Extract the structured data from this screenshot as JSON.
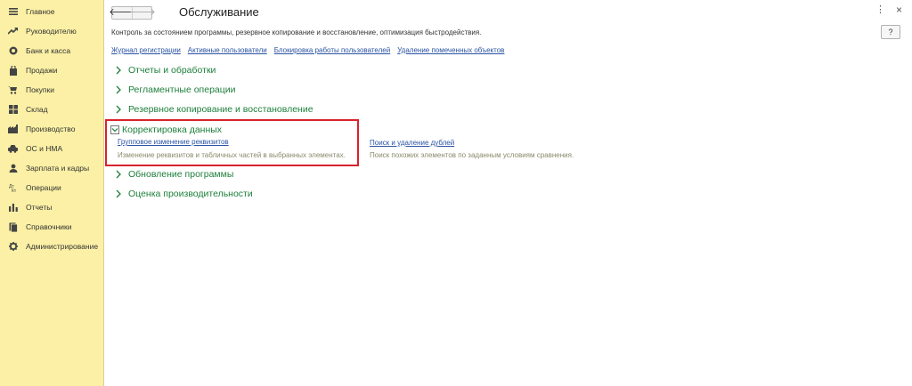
{
  "sidebar": {
    "items": [
      {
        "label": "Главное",
        "icon": "menu-icon"
      },
      {
        "label": "Руководителю",
        "icon": "trend-icon"
      },
      {
        "label": "Банк и касса",
        "icon": "coins-icon"
      },
      {
        "label": "Продажи",
        "icon": "bag-icon"
      },
      {
        "label": "Покупки",
        "icon": "cart-icon"
      },
      {
        "label": "Склад",
        "icon": "warehouse-icon"
      },
      {
        "label": "Производство",
        "icon": "factory-icon"
      },
      {
        "label": "ОС и НМА",
        "icon": "car-icon"
      },
      {
        "label": "Зарплата и кадры",
        "icon": "people-icon"
      },
      {
        "label": "Операции",
        "icon": "operations-icon"
      },
      {
        "label": "Отчеты",
        "icon": "bar-chart-icon"
      },
      {
        "label": "Справочники",
        "icon": "books-icon"
      },
      {
        "label": "Администрирование",
        "icon": "gear-icon"
      }
    ]
  },
  "header": {
    "back_glyph": "🡐",
    "forward_glyph": "🡒",
    "title": "Обслуживание",
    "more_glyph": "⋮",
    "close_glyph": "×",
    "help_label": "?"
  },
  "description": "Контроль за состоянием программы, резервное копирование и восстановление, оптимизация быстродействия.",
  "links": [
    "Журнал регистрации",
    "Активные пользователи",
    "Блокировка работы пользователей",
    "Удаление помеченных объектов"
  ],
  "sections": {
    "reports": "Отчеты и обработки",
    "scheduled": "Регламентные операции",
    "backup": "Резервное копирование и восстановление",
    "data_correction": {
      "title": "Корректировка данных",
      "items": [
        {
          "link": "Групповое изменение реквизитов",
          "desc": "Изменение реквизитов и табличных частей в выбранных элементах."
        },
        {
          "link": "Поиск и удаление дублей",
          "desc": "Поиск похожих элементов по заданным условиям сравнения."
        }
      ]
    },
    "update": "Обновление программы",
    "performance": "Оценка производительности"
  },
  "colors": {
    "sidebar_bg": "#fbf0a5",
    "section_green": "#1e7f3b",
    "link_blue": "#2a53a3",
    "highlight_red": "#d9232e"
  }
}
